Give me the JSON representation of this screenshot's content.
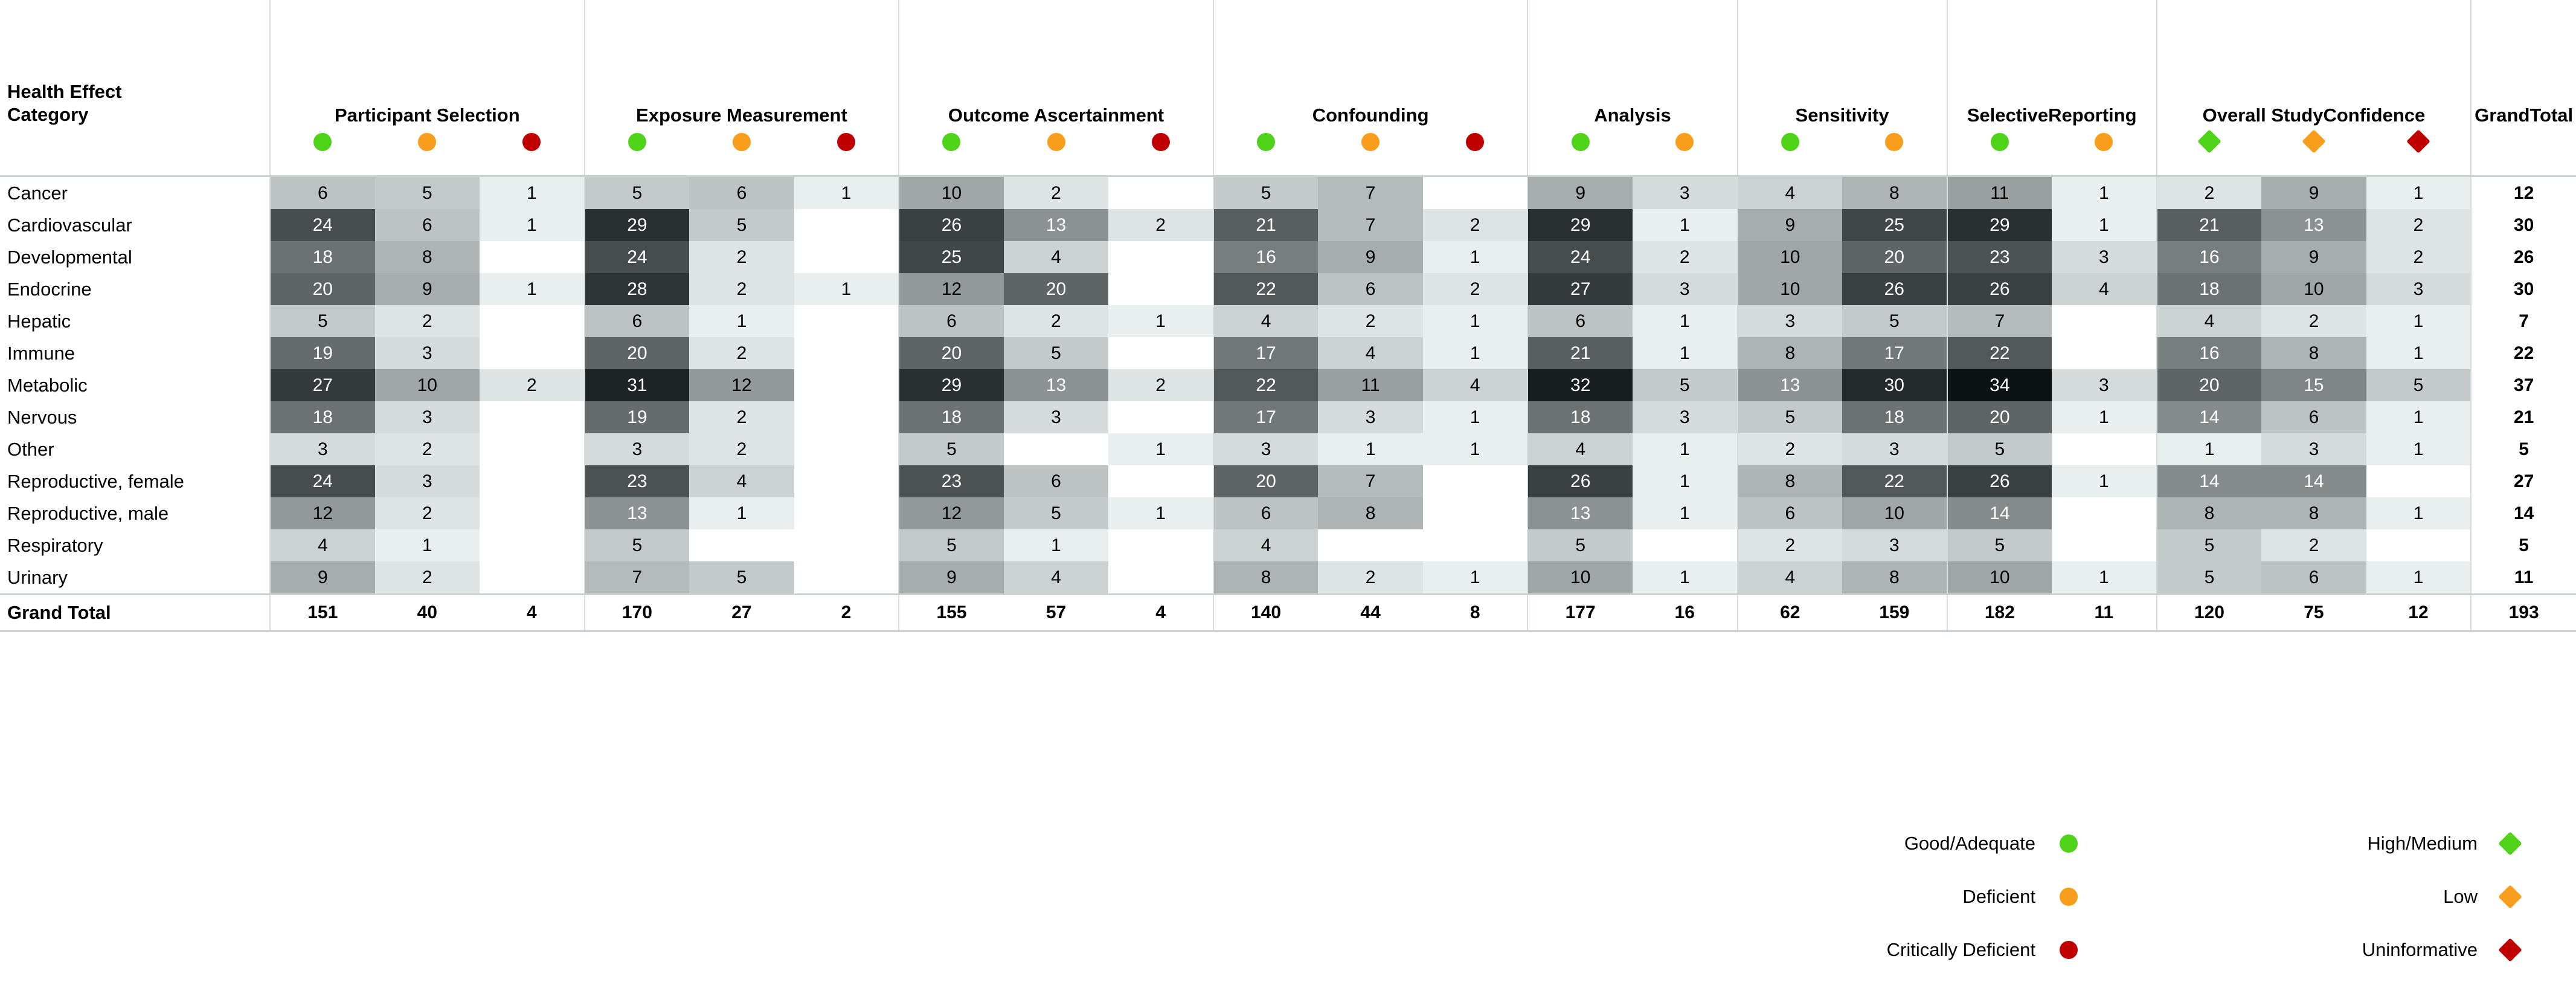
{
  "colors": {
    "green": "#4fd319",
    "orange": "#f99d1c",
    "red": "#c00000",
    "grid": "#d6dcdc"
  },
  "corner": {
    "line1": "Health Effect",
    "line2": "Category"
  },
  "groups": [
    {
      "label": "Participant Selection",
      "shape": "circle",
      "icons": [
        "green",
        "orange",
        "red"
      ]
    },
    {
      "label": "Exposure Measurement",
      "shape": "circle",
      "icons": [
        "green",
        "orange",
        "red"
      ]
    },
    {
      "label": "Outcome Ascertainment",
      "shape": "circle",
      "icons": [
        "green",
        "orange",
        "red"
      ]
    },
    {
      "label": "Confounding",
      "shape": "circle",
      "icons": [
        "green",
        "orange",
        "red"
      ]
    },
    {
      "label": "Analysis",
      "shape": "circle",
      "icons": [
        "green",
        "orange"
      ]
    },
    {
      "label": "Sensitivity",
      "shape": "circle",
      "icons": [
        "green",
        "orange"
      ]
    },
    {
      "label": "Selective\nReporting",
      "line1": "Selective",
      "line2": "Reporting",
      "shape": "circle",
      "icons": [
        "green",
        "orange"
      ]
    },
    {
      "label": "Overall Study Confidence",
      "line1": "Overall Study",
      "line2": "Confidence",
      "shape": "diamond",
      "icons": [
        "green",
        "orange",
        "red"
      ]
    },
    {
      "label": "Grand Total",
      "line1": "Grand",
      "line2": "Total",
      "shape": "none",
      "icons": []
    }
  ],
  "row_header": "Health Effect Category",
  "rows": [
    {
      "label": "Cancer",
      "values": [
        6,
        5,
        1,
        5,
        6,
        1,
        10,
        2,
        null,
        5,
        7,
        null,
        9,
        3,
        4,
        8,
        11,
        1,
        2,
        9,
        1,
        12
      ]
    },
    {
      "label": "Cardiovascular",
      "values": [
        24,
        6,
        1,
        29,
        5,
        null,
        26,
        13,
        2,
        21,
        7,
        2,
        29,
        1,
        9,
        25,
        29,
        1,
        21,
        13,
        2,
        30
      ]
    },
    {
      "label": "Developmental",
      "values": [
        18,
        8,
        null,
        24,
        2,
        null,
        25,
        4,
        null,
        16,
        9,
        1,
        24,
        2,
        10,
        20,
        23,
        3,
        16,
        9,
        2,
        26
      ]
    },
    {
      "label": "Endocrine",
      "values": [
        20,
        9,
        1,
        28,
        2,
        1,
        12,
        20,
        null,
        22,
        6,
        2,
        27,
        3,
        10,
        26,
        26,
        4,
        18,
        10,
        3,
        30
      ]
    },
    {
      "label": "Hepatic",
      "values": [
        5,
        2,
        null,
        6,
        1,
        null,
        6,
        2,
        1,
        4,
        2,
        1,
        6,
        1,
        3,
        5,
        7,
        null,
        4,
        2,
        1,
        7
      ]
    },
    {
      "label": "Immune",
      "values": [
        19,
        3,
        null,
        20,
        2,
        null,
        20,
        5,
        null,
        17,
        4,
        1,
        21,
        1,
        8,
        17,
        22,
        null,
        16,
        8,
        1,
        22
      ]
    },
    {
      "label": "Metabolic",
      "values": [
        27,
        10,
        2,
        31,
        12,
        null,
        29,
        13,
        2,
        22,
        11,
        4,
        32,
        5,
        13,
        30,
        34,
        3,
        20,
        15,
        5,
        37
      ]
    },
    {
      "label": "Nervous",
      "values": [
        18,
        3,
        null,
        19,
        2,
        null,
        18,
        3,
        null,
        17,
        3,
        1,
        18,
        3,
        5,
        18,
        20,
        1,
        14,
        6,
        1,
        21
      ]
    },
    {
      "label": "Other",
      "values": [
        3,
        2,
        null,
        3,
        2,
        null,
        5,
        null,
        1,
        3,
        1,
        1,
        4,
        1,
        2,
        3,
        5,
        null,
        1,
        3,
        1,
        5
      ]
    },
    {
      "label": "Reproductive, female",
      "values": [
        24,
        3,
        null,
        23,
        4,
        null,
        23,
        6,
        null,
        20,
        7,
        null,
        26,
        1,
        8,
        22,
        26,
        1,
        14,
        14,
        null,
        27
      ]
    },
    {
      "label": "Reproductive, male",
      "values": [
        12,
        2,
        null,
        13,
        1,
        null,
        12,
        5,
        1,
        6,
        8,
        null,
        13,
        1,
        6,
        10,
        14,
        null,
        8,
        8,
        1,
        14
      ]
    },
    {
      "label": "Respiratory",
      "values": [
        4,
        1,
        null,
        5,
        null,
        null,
        5,
        1,
        null,
        4,
        null,
        null,
        5,
        null,
        2,
        3,
        5,
        null,
        5,
        2,
        null,
        5
      ]
    },
    {
      "label": "Urinary",
      "values": [
        9,
        2,
        null,
        7,
        5,
        null,
        9,
        4,
        null,
        8,
        2,
        1,
        10,
        1,
        4,
        8,
        10,
        1,
        5,
        6,
        1,
        11
      ]
    }
  ],
  "grand_total": {
    "label": "Grand Total",
    "values": [
      151,
      40,
      4,
      170,
      27,
      2,
      155,
      57,
      4,
      140,
      44,
      8,
      177,
      16,
      62,
      159,
      182,
      11,
      120,
      75,
      12,
      193
    ]
  },
  "legend": {
    "rows": [
      {
        "left_label": "Good/Adequate",
        "left_shape": "circle",
        "left_color": "green",
        "right_label": "High/Medium",
        "right_shape": "diamond",
        "right_color": "green"
      },
      {
        "left_label": "Deficient",
        "left_shape": "circle",
        "left_color": "orange",
        "right_label": "Low",
        "right_shape": "diamond",
        "right_color": "orange"
      },
      {
        "left_label": "Critically Deficient",
        "left_shape": "circle",
        "left_color": "red",
        "right_label": "Uninformative",
        "right_shape": "diamond",
        "right_color": "red"
      }
    ]
  },
  "chart_data": {
    "type": "heatmap",
    "title": "Health Effect Category by Study Quality Domain",
    "xlabel": "",
    "ylabel": "Health Effect Category",
    "row_categories": [
      "Cancer",
      "Cardiovascular",
      "Developmental",
      "Endocrine",
      "Hepatic",
      "Immune",
      "Metabolic",
      "Nervous",
      "Other",
      "Reproductive, female",
      "Reproductive, male",
      "Respiratory",
      "Urinary"
    ],
    "column_groups": [
      {
        "name": "Participant Selection",
        "ratings": [
          "Good/Adequate",
          "Deficient",
          "Critically Deficient"
        ]
      },
      {
        "name": "Exposure Measurement",
        "ratings": [
          "Good/Adequate",
          "Deficient",
          "Critically Deficient"
        ]
      },
      {
        "name": "Outcome Ascertainment",
        "ratings": [
          "Good/Adequate",
          "Deficient",
          "Critically Deficient"
        ]
      },
      {
        "name": "Confounding",
        "ratings": [
          "Good/Adequate",
          "Deficient",
          "Critically Deficient"
        ]
      },
      {
        "name": "Analysis",
        "ratings": [
          "Good/Adequate",
          "Deficient"
        ]
      },
      {
        "name": "Sensitivity",
        "ratings": [
          "Good/Adequate",
          "Deficient"
        ]
      },
      {
        "name": "Selective Reporting",
        "ratings": [
          "Good/Adequate",
          "Deficient"
        ]
      },
      {
        "name": "Overall Study Confidence",
        "ratings": [
          "High/Medium",
          "Low",
          "Uninformative"
        ]
      },
      {
        "name": "Grand Total",
        "ratings": []
      }
    ],
    "matrix": [
      [
        6,
        5,
        1,
        5,
        6,
        1,
        10,
        2,
        null,
        5,
        7,
        null,
        9,
        3,
        4,
        8,
        11,
        1,
        2,
        9,
        1,
        12
      ],
      [
        24,
        6,
        1,
        29,
        5,
        null,
        26,
        13,
        2,
        21,
        7,
        2,
        29,
        1,
        9,
        25,
        29,
        1,
        21,
        13,
        2,
        30
      ],
      [
        18,
        8,
        null,
        24,
        2,
        null,
        25,
        4,
        null,
        16,
        9,
        1,
        24,
        2,
        10,
        20,
        23,
        3,
        16,
        9,
        2,
        26
      ],
      [
        20,
        9,
        1,
        28,
        2,
        1,
        12,
        20,
        null,
        22,
        6,
        2,
        27,
        3,
        10,
        26,
        26,
        4,
        18,
        10,
        3,
        30
      ],
      [
        5,
        2,
        null,
        6,
        1,
        null,
        6,
        2,
        1,
        4,
        2,
        1,
        6,
        1,
        3,
        5,
        7,
        null,
        4,
        2,
        1,
        7
      ],
      [
        19,
        3,
        null,
        20,
        2,
        null,
        20,
        5,
        null,
        17,
        4,
        1,
        21,
        1,
        8,
        17,
        22,
        null,
        16,
        8,
        1,
        22
      ],
      [
        27,
        10,
        2,
        31,
        12,
        null,
        29,
        13,
        2,
        22,
        11,
        4,
        32,
        5,
        13,
        30,
        34,
        3,
        20,
        15,
        5,
        37
      ],
      [
        18,
        3,
        null,
        19,
        2,
        null,
        18,
        3,
        null,
        17,
        3,
        1,
        18,
        3,
        5,
        18,
        20,
        1,
        14,
        6,
        1,
        21
      ],
      [
        3,
        2,
        null,
        3,
        2,
        null,
        5,
        null,
        1,
        3,
        1,
        1,
        4,
        1,
        2,
        3,
        5,
        null,
        1,
        3,
        1,
        5
      ],
      [
        24,
        3,
        null,
        23,
        4,
        null,
        23,
        6,
        null,
        20,
        7,
        null,
        26,
        1,
        8,
        22,
        26,
        1,
        14,
        14,
        null,
        27
      ],
      [
        12,
        2,
        null,
        13,
        1,
        null,
        12,
        5,
        1,
        6,
        8,
        null,
        13,
        1,
        6,
        10,
        14,
        null,
        8,
        8,
        1,
        14
      ],
      [
        4,
        1,
        null,
        5,
        null,
        null,
        5,
        1,
        null,
        4,
        null,
        null,
        5,
        null,
        2,
        3,
        5,
        null,
        5,
        2,
        null,
        5
      ],
      [
        9,
        2,
        null,
        7,
        5,
        null,
        9,
        4,
        null,
        8,
        2,
        1,
        10,
        1,
        4,
        8,
        10,
        1,
        5,
        6,
        1,
        11
      ]
    ],
    "column_totals": [
      151,
      40,
      4,
      170,
      27,
      2,
      155,
      57,
      4,
      140,
      44,
      8,
      177,
      16,
      62,
      159,
      182,
      11,
      120,
      75,
      12,
      193
    ],
    "row_totals": [
      12,
      30,
      26,
      30,
      7,
      22,
      37,
      21,
      5,
      27,
      14,
      5,
      11
    ],
    "grand_total": 193,
    "color_scale": {
      "min": 1,
      "max": 34,
      "low_color": "#eef2f2",
      "high_color": "#0d0f0f"
    },
    "legend_position": "bottom-right"
  }
}
